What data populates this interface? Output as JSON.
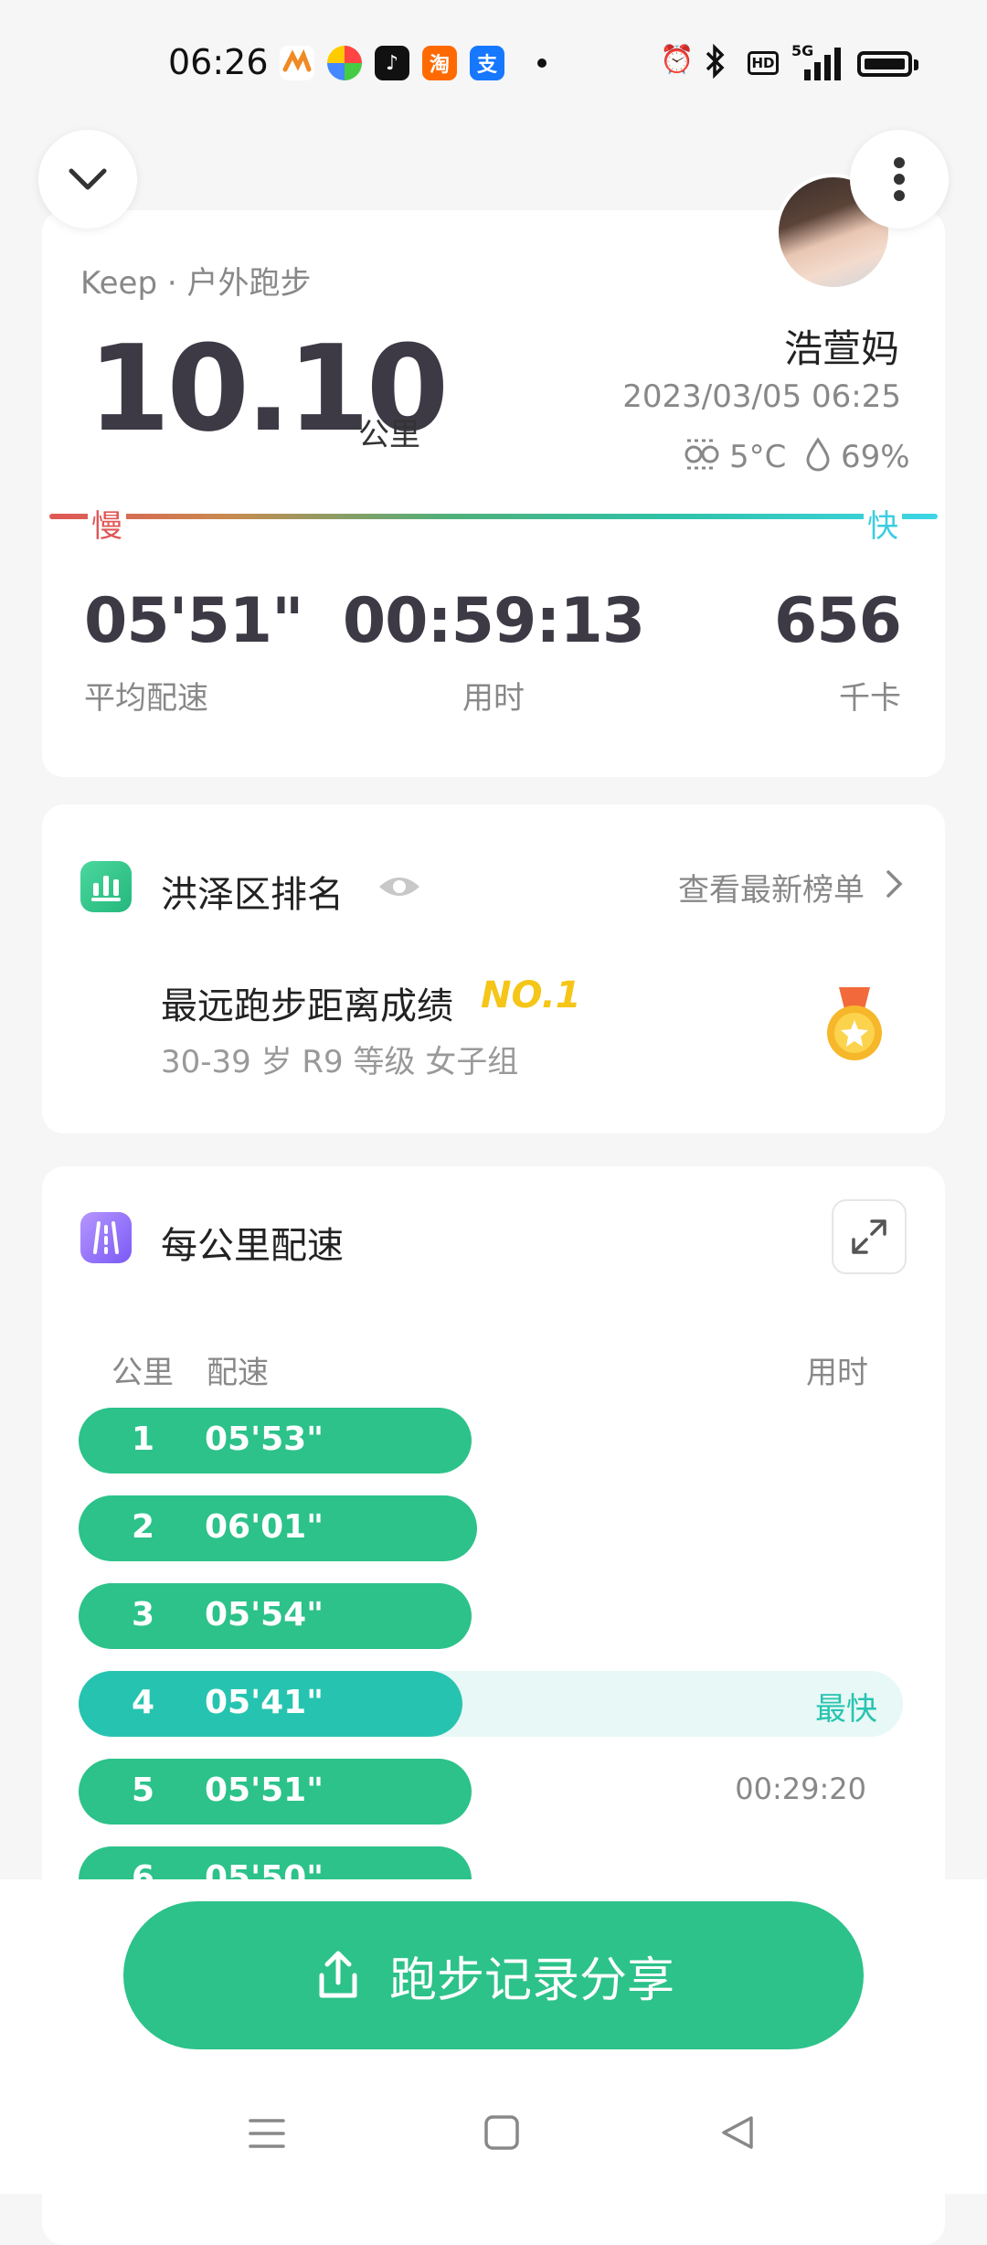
{
  "status": {
    "time": "06:26",
    "app_icons": [
      "huawei-health-icon",
      "colorful-app-icon",
      "tiktok-icon",
      "taobao-icon",
      "alipay-icon"
    ],
    "indicators": [
      "alarm-icon",
      "bluetooth-icon",
      "hd-icon",
      "5g-signal-icon",
      "battery-icon"
    ],
    "network_label": "5G",
    "hd_label": "HD"
  },
  "summary": {
    "source": "Keep · 户外跑步",
    "distance": "10.10",
    "distance_unit": "公里",
    "user_name": "浩萱妈",
    "datetime": "2023/03/05 06:25",
    "temperature": "5°C",
    "humidity": "69%",
    "slow_label": "慢",
    "fast_label": "快",
    "metrics": [
      {
        "value": "05'51\"",
        "label": "平均配速"
      },
      {
        "value": "00:59:13",
        "label": "用时"
      },
      {
        "value": "656",
        "label": "千卡"
      }
    ]
  },
  "ranking": {
    "title": "洪泽区排名",
    "link": "查看最新榜单",
    "achievement": "最远跑步距离成绩",
    "rank": "NO.1",
    "group": "30-39 岁 R9 等级 女子组"
  },
  "pace": {
    "title": "每公里配速",
    "col_km": "公里",
    "col_pace": "配速",
    "col_time": "用时",
    "rows": [
      {
        "km": "1",
        "pace": "05'53\"",
        "fill": 0.4762,
        "note": "",
        "time": ""
      },
      {
        "km": "2",
        "pace": "06'01\"",
        "fill": 0.483,
        "note": "",
        "time": ""
      },
      {
        "km": "3",
        "pace": "05'54\"",
        "fill": 0.4762,
        "note": "",
        "time": ""
      },
      {
        "km": "4",
        "pace": "05'41\"",
        "fill": 0.466,
        "note": "最快",
        "time": ""
      },
      {
        "km": "5",
        "pace": "05'51\"",
        "fill": 0.4762,
        "note": "",
        "time": "00:29:20"
      },
      {
        "km": "6",
        "pace": "05'50\"",
        "fill": 0.4762,
        "note": "",
        "time": ""
      }
    ]
  },
  "share_button": "跑步记录分享",
  "colors": {
    "accent": "#2cc28a",
    "fastest": "#26c4b0",
    "gold": "#f5c518"
  }
}
